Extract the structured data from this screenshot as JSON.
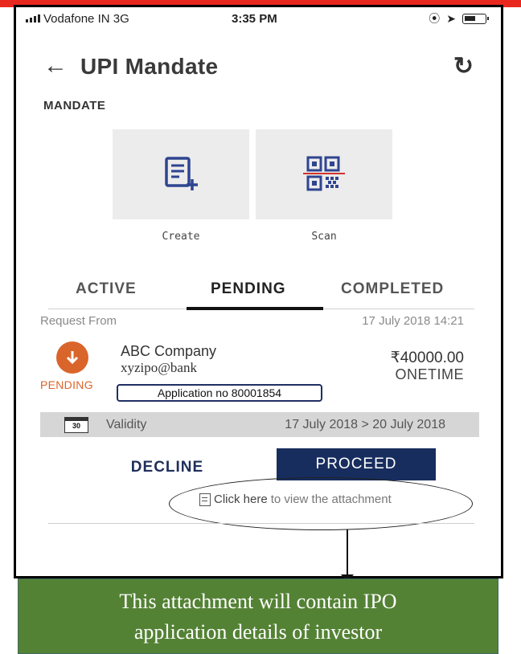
{
  "status_bar": {
    "carrier": "Vodafone IN  3G",
    "time": "3:35 PM"
  },
  "header": {
    "title": "UPI Mandate",
    "back_icon": "arrow-left-icon",
    "refresh_icon": "refresh-icon"
  },
  "section": {
    "label": "MANDATE"
  },
  "actions": [
    {
      "label": "Create",
      "icon": "create-document-icon"
    },
    {
      "label": "Scan",
      "icon": "qr-scan-icon"
    }
  ],
  "tabs": [
    {
      "label": "ACTIVE",
      "active": false
    },
    {
      "label": "PENDING",
      "active": true
    },
    {
      "label": "COMPLETED",
      "active": false
    }
  ],
  "request": {
    "from_label": "Request From",
    "datetime": "17 July 2018 14:21",
    "status": "PENDING",
    "company": "ABC Company",
    "vpa": "xyzipo@bank",
    "amount": "₹40000.00",
    "frequency": "ONETIME",
    "application_no": "Application no 80001854",
    "validity_label": "Validity",
    "calendar_day": "30",
    "validity_range": "17 July 2018 > 20 July 2018"
  },
  "buttons": {
    "decline": "DECLINE",
    "proceed": "PROCEED"
  },
  "attachment": {
    "link_strong": "Click here",
    "link_soft": "to view the attachment"
  },
  "callout": {
    "line1": "This attachment will contain IPO",
    "line2": "application details of investor"
  },
  "colors": {
    "accent_red": "#e8281e",
    "pending_orange": "#d9652b",
    "primary_navy": "#172d5e",
    "callout_green": "#548235"
  }
}
